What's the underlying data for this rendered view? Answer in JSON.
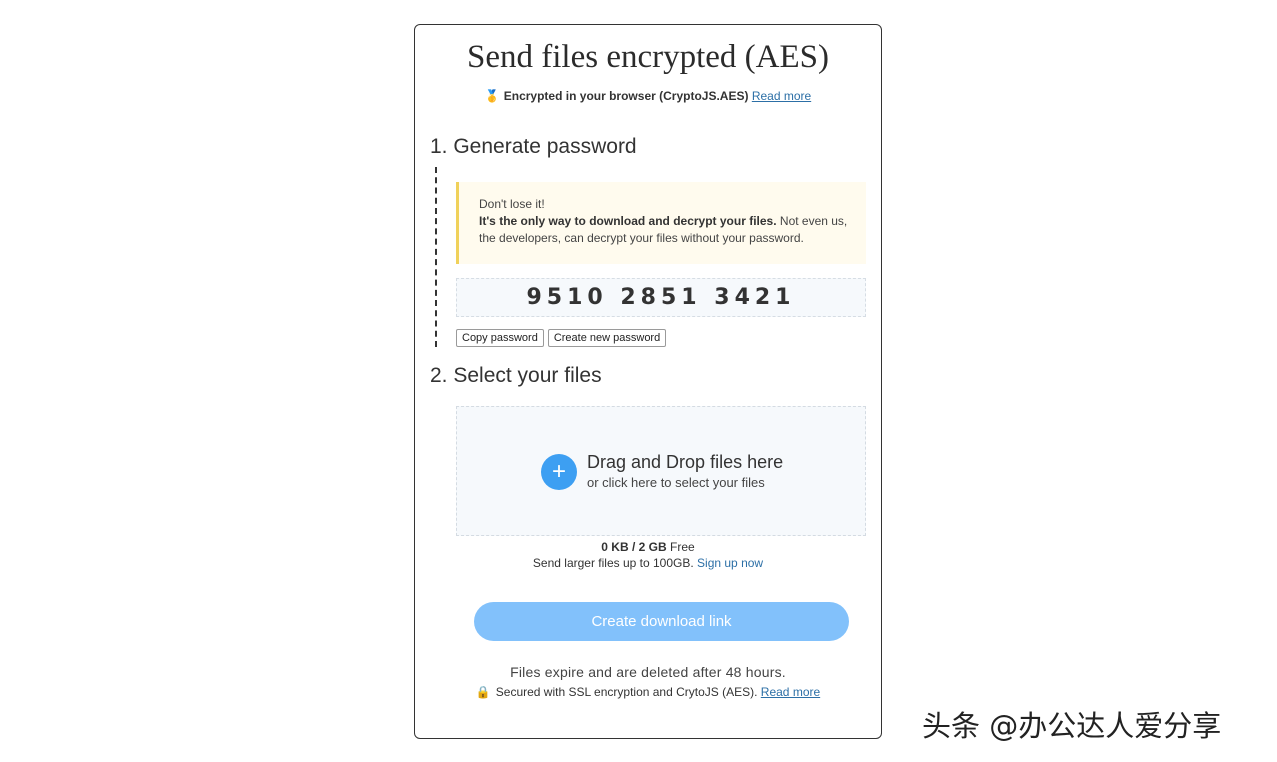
{
  "header": {
    "title": "Send files encrypted (AES)",
    "subtitle_icon": "🥇",
    "subtitle_text": "Encrypted in your browser (CryptoJS.AES)",
    "subtitle_link": "Read more"
  },
  "step1": {
    "heading": "1. Generate password",
    "warning_line1": "Don't lose it!",
    "warning_bold": "It's the only way to download and decrypt your files.",
    "warning_rest": " Not even us, the developers, can decrypt your files without your password.",
    "password": "9510 2851 3421",
    "copy_button": "Copy password",
    "new_button": "Create new password"
  },
  "step2": {
    "heading": "2. Select your files",
    "plus_icon": "+",
    "drop_title": "Drag and Drop files here",
    "drop_sub": "or click here to select your files",
    "quota_used": "0 KB",
    "quota_sep": " / ",
    "quota_total": "2 GB",
    "quota_suffix": " Free",
    "upsell_text": "Send larger files up to 100GB. ",
    "upsell_link": "Sign up now"
  },
  "actions": {
    "create_link": "Create download link"
  },
  "footer": {
    "expire_text": "Files expire and are deleted after 48 hours.",
    "lock_icon": "🔒",
    "secured_text": "Secured with SSL encryption and CrytoJS (AES). ",
    "secured_link": "Read more"
  },
  "watermark": "头条 @办公达人爱分享",
  "colors": {
    "accent": "#3d9ff2",
    "button": "#82c1fb",
    "warning_border": "#f0d15a",
    "warning_bg": "#fffbee",
    "link": "#2c6fa6"
  }
}
